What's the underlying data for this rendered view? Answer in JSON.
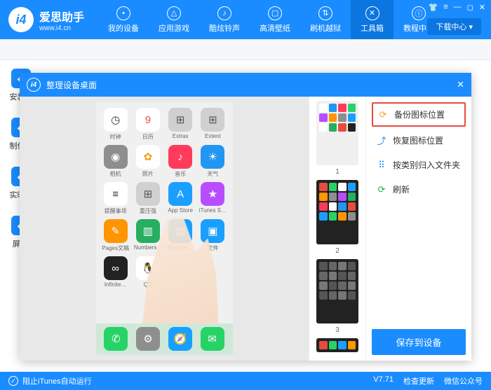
{
  "brand": {
    "name": "爱思助手",
    "url": "www.i4.cn"
  },
  "nav": [
    {
      "label": "我的设备"
    },
    {
      "label": "应用游戏"
    },
    {
      "label": "酷炫铃声"
    },
    {
      "label": "高清壁纸"
    },
    {
      "label": "刷机越狱"
    },
    {
      "label": "工具箱",
      "active": true
    },
    {
      "label": "教程中心"
    }
  ],
  "download_btn": "下载中心 ▾",
  "sidebar": [
    {
      "label": "安装移"
    },
    {
      "label": "制作铃"
    },
    {
      "label": "实时排"
    },
    {
      "label": "屏蔽i"
    }
  ],
  "modal": {
    "title": "整理设备桌面",
    "actions": [
      {
        "label": "备份图标位置",
        "color": "#f5a623",
        "highlight": true,
        "icon": "⟳"
      },
      {
        "label": "恢复图标位置",
        "color": "#1a8cff",
        "icon": "⤴"
      },
      {
        "label": "按类别归入文件夹",
        "color": "#1a8cff",
        "icon": "⠿"
      },
      {
        "label": "刷新",
        "color": "#27ae60",
        "icon": "⟳"
      }
    ],
    "save": "保存到设备",
    "pages": [
      "1",
      "2",
      "3"
    ]
  },
  "apps": [
    {
      "lbl": "时钟",
      "bg": "#fff",
      "fg": "#333",
      "t": "◷"
    },
    {
      "lbl": "日历",
      "bg": "#fff",
      "fg": "#e74c3c",
      "t": "9"
    },
    {
      "lbl": "Extras",
      "bg": "#d0d0d0",
      "fg": "#555",
      "t": "⊞"
    },
    {
      "lbl": "Extent",
      "bg": "#d0d0d0",
      "fg": "#555",
      "t": "⊞"
    },
    {
      "lbl": "相机",
      "bg": "#8e8e8e",
      "fg": "#fff",
      "t": "◉"
    },
    {
      "lbl": "照片",
      "bg": "#fff",
      "fg": "#f39c12",
      "t": "✿"
    },
    {
      "lbl": "音乐",
      "bg": "#ff3b5c",
      "fg": "#fff",
      "t": "♪"
    },
    {
      "lbl": "天气",
      "bg": "#2196f3",
      "fg": "#fff",
      "t": "☀"
    },
    {
      "lbl": "提醒事项",
      "bg": "#fff",
      "fg": "#333",
      "t": "≡"
    },
    {
      "lbl": "重压强",
      "bg": "#d0d0d0",
      "fg": "#555",
      "t": "⊞"
    },
    {
      "lbl": "App Store",
      "bg": "#1a9fff",
      "fg": "#fff",
      "t": "A"
    },
    {
      "lbl": "iTunes S…",
      "bg": "#b84dff",
      "fg": "#fff",
      "t": "★"
    },
    {
      "lbl": "Pages文稿",
      "bg": "#ff9500",
      "fg": "#fff",
      "t": "✎"
    },
    {
      "lbl": "Numbers…",
      "bg": "#27ae60",
      "fg": "#fff",
      "t": "▥"
    },
    {
      "lbl": "Keynote…",
      "bg": "#1a9fff",
      "fg": "#fff",
      "t": "▤"
    },
    {
      "lbl": "文件",
      "bg": "#1a9fff",
      "fg": "#fff",
      "t": "▣"
    },
    {
      "lbl": "Infinite…",
      "bg": "#222",
      "fg": "#fff",
      "t": "∞"
    },
    {
      "lbl": "QQ",
      "bg": "#fff",
      "fg": "#e74c3c",
      "t": "🐧"
    }
  ],
  "dock": [
    {
      "bg": "#27d266",
      "t": "✆"
    },
    {
      "bg": "#8e8e8e",
      "t": "⚙"
    },
    {
      "bg": "#1a9fff",
      "t": "🧭"
    },
    {
      "bg": "#27d266",
      "t": "✉"
    }
  ],
  "footer": {
    "block": "阻止iTunes自动运行",
    "version": "V7.71",
    "update": "检查更新",
    "wechat": "微信公众号"
  }
}
